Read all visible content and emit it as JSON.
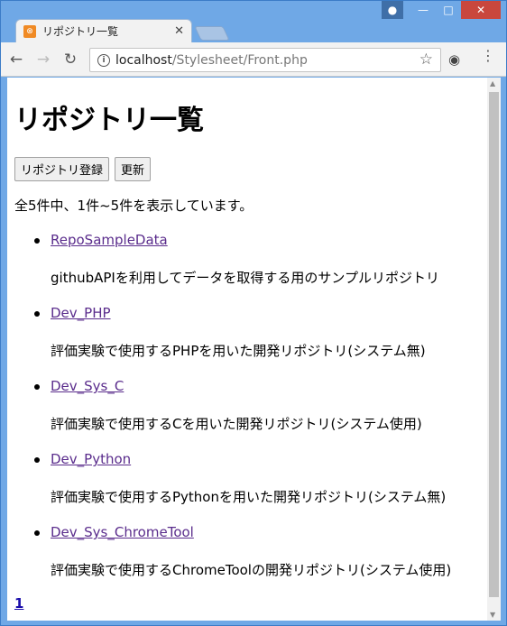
{
  "browser": {
    "tab_title": "リポジトリ一覧",
    "tab_favicon": "xampp-icon",
    "url_host": "localhost",
    "url_path": "/Stylesheet/Front.php"
  },
  "page": {
    "heading": "リポジトリ一覧",
    "buttons": {
      "register": "リポジトリ登録",
      "refresh": "更新"
    },
    "summary": "全5件中、1件~5件を表示しています。",
    "repos": [
      {
        "name": "RepoSampleData",
        "description": "githubAPIを利用してデータを取得する用のサンプルリポジトリ"
      },
      {
        "name": "Dev_PHP",
        "description": "評価実験で使用するPHPを用いた開発リポジトリ(システム無)"
      },
      {
        "name": "Dev_Sys_C",
        "description": "評価実験で使用するCを用いた開発リポジトリ(システム使用)"
      },
      {
        "name": "Dev_Python",
        "description": "評価実験で使用するPythonを用いた開発リポジトリ(システム無)"
      },
      {
        "name": "Dev_Sys_ChromeTool",
        "description": "評価実験で使用するChromeToolの開発リポジトリ(システム使用)"
      }
    ],
    "pager": "1"
  },
  "colors": {
    "link_visited": "#5a2c8c",
    "window_frame": "#6fa8e6",
    "close_button": "#c9473d"
  }
}
